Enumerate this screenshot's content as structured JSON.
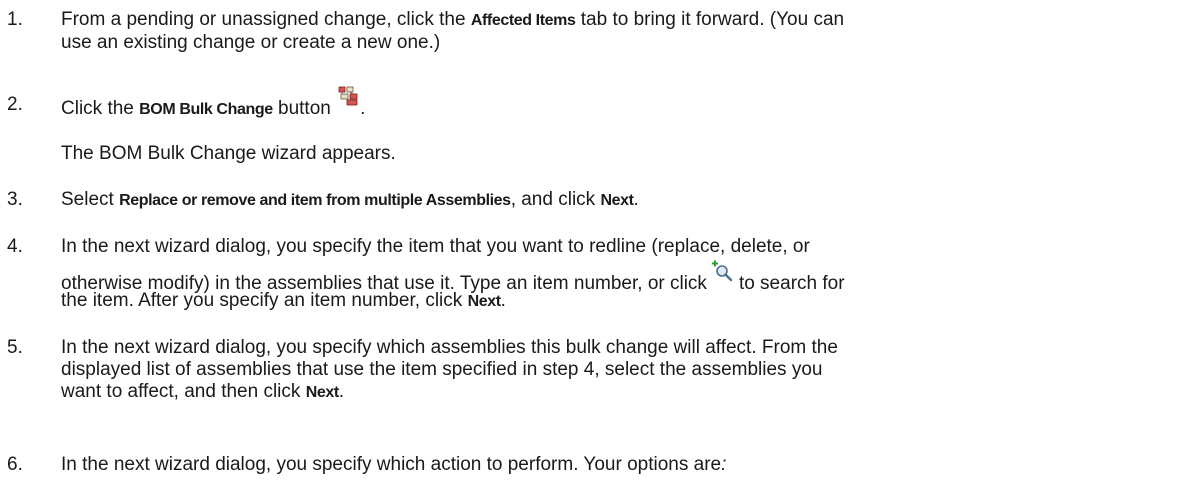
{
  "steps": [
    {
      "num": "1.",
      "line1_a": "From a pending or unassigned change, click the ",
      "line1_bold": "Affected Items",
      "line1_b": " tab to bring it forward. (You can",
      "line2": "use an existing change or create a new one.)"
    },
    {
      "num": "2.",
      "a": "Click the ",
      "bold": "BOM Bulk Change",
      "b": " button",
      "c": ".",
      "sub": "The BOM Bulk Change wizard appears."
    },
    {
      "num": "3.",
      "a": "Select ",
      "bold1": "Replace or remove and item from multiple Assemblies",
      "b": ", and click ",
      "bold2": "Next",
      "c": "."
    },
    {
      "num": "4.",
      "line1": "In the next wizard dialog, you specify the item that you want to redline (replace, delete, or",
      "line2_a": "otherwise modify) in the assemblies that use it. Type an item number, or click",
      "line2_b": "to search for",
      "line3_a": "the item. After you specify an item number, click ",
      "line3_bold": "Next",
      "line3_b": "."
    },
    {
      "num": "5.",
      "line1": "In the next wizard dialog, you specify which assemblies this bulk change will affect. From the",
      "line2": "displayed list of assemblies that use the item specified in step 4, select the assemblies you",
      "line3_a": "want to affect, and then click ",
      "line3_bold": "Next",
      "line3_b": "."
    },
    {
      "num": "6.",
      "line1": "In the next wizard dialog, you specify which action to perform. Your options are",
      "line1_italic": ":"
    }
  ],
  "icons": {
    "bom_bulk_change": "bom-bulk-change-icon",
    "search": "search-icon"
  }
}
